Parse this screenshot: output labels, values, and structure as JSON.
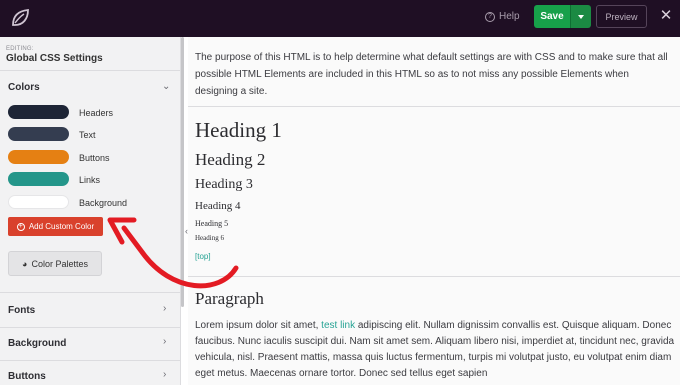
{
  "topbar": {
    "help_label": "Help",
    "save_label": "Save",
    "preview_label": "Preview",
    "close_glyph": "✕"
  },
  "sidebar": {
    "editing_label": "EDITING:",
    "title": "Global CSS Settings",
    "colors_title": "Colors",
    "colors": [
      {
        "label": "Headers",
        "color": "#1e2536"
      },
      {
        "label": "Text",
        "color": "#343d50"
      },
      {
        "label": "Buttons",
        "color": "#e58013"
      },
      {
        "label": "Links",
        "color": "#24968a"
      },
      {
        "label": "Background",
        "color": "#ffffff"
      }
    ],
    "add_color_label": "Add Custom Color",
    "palettes_label": "Color Palettes",
    "sections": [
      "Fonts",
      "Background",
      "Buttons"
    ]
  },
  "content": {
    "intro": "The purpose of this HTML is to help determine what default settings are with CSS and to make sure that all possible HTML Elements are included in this HTML so as to not miss any possible Elements when designing a site.",
    "headings": [
      "Heading 1",
      "Heading 2",
      "Heading 3",
      "Heading 4",
      "Heading 5",
      "Heading 6"
    ],
    "top_link": "[top]",
    "paragraph_title": "Paragraph",
    "paragraph_before": "Lorem ipsum dolor sit amet, ",
    "paragraph_link": "test link",
    "paragraph_after": " adipiscing elit. Nullam dignissim convallis est. Quisque aliquam. Donec faucibus. Nunc iaculis suscipit dui. Nam sit amet sem. Aliquam libero nisi, imperdiet at, tincidunt nec, gravida vehicula, nisl. Praesent mattis, massa quis luctus fermentum, turpis mi volutpat justo, eu volutpat enim diam eget metus. Maecenas ornare tortor. Donec sed tellus eget sapien"
  },
  "colors": {
    "topbar_bg": "#1f0f24",
    "save_green": "#17a04a",
    "accent_red": "#d9412c",
    "link_teal": "#27a394"
  }
}
